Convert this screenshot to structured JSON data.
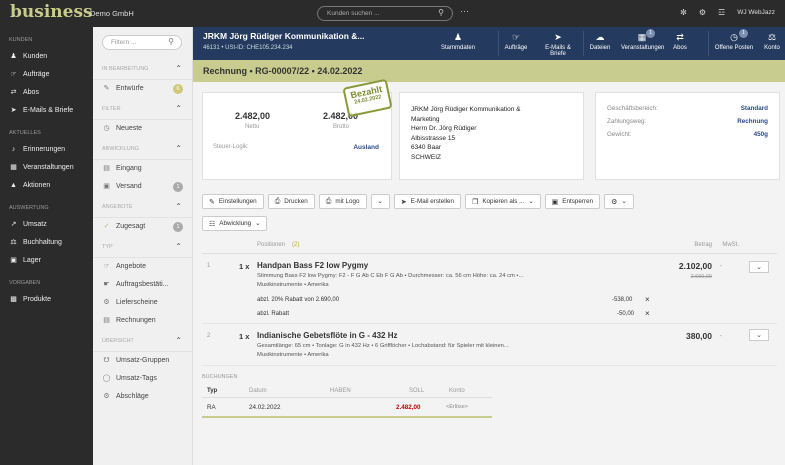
{
  "app": {
    "logo": "business",
    "company": "Demo GmbH",
    "user": "WJ WebJazz"
  },
  "search": {
    "placeholder": "Kunden suchen ..."
  },
  "leftnav": {
    "sections": [
      {
        "label": "KUNDEN",
        "items": [
          {
            "label": "Kunden",
            "icon": "person-icon"
          },
          {
            "label": "Aufträge",
            "icon": "handshake-icon"
          },
          {
            "label": "Abos",
            "icon": "repeat-icon"
          },
          {
            "label": "E-Mails & Briefe",
            "icon": "send-icon"
          }
        ]
      },
      {
        "label": "AKTUELLES",
        "items": [
          {
            "label": "Erinnerungen",
            "icon": "bell-icon"
          },
          {
            "label": "Veranstaltungen",
            "icon": "calendar-icon"
          },
          {
            "label": "Aktionen",
            "icon": "megaphone-icon"
          }
        ]
      },
      {
        "label": "AUSWERTUNG",
        "items": [
          {
            "label": "Umsatz",
            "icon": "chart-icon"
          },
          {
            "label": "Buchhaltung",
            "icon": "scale-icon"
          },
          {
            "label": "Lager",
            "icon": "forklift-icon"
          }
        ]
      },
      {
        "label": "VORGABEN",
        "items": [
          {
            "label": "Produkte",
            "icon": "box-icon"
          }
        ]
      }
    ]
  },
  "side2": {
    "filter_placeholder": "Filtern ...",
    "groups": [
      {
        "label": "IN BEARBEITUNG",
        "items": [
          {
            "label": "Entwürfe",
            "badge": "6"
          }
        ]
      },
      {
        "label": "FILTER",
        "items": [
          {
            "label": "Neueste"
          }
        ]
      },
      {
        "label": "ABWICKLUNG",
        "items": [
          {
            "label": "Eingang"
          },
          {
            "label": "Versand",
            "badge": "1"
          }
        ]
      },
      {
        "label": "ANGEBOTE",
        "items": [
          {
            "label": "Zugesagt",
            "badge": "1"
          }
        ]
      },
      {
        "label": "TYP",
        "items": [
          {
            "label": "Angebote"
          },
          {
            "label": "Auftragsbestäti..."
          },
          {
            "label": "Lieferscheine"
          },
          {
            "label": "Rechnungen"
          }
        ]
      },
      {
        "label": "ÜBERSICHT",
        "items": [
          {
            "label": "Umsatz-Gruppen"
          },
          {
            "label": "Umsatz-Tags"
          },
          {
            "label": "Abschläge"
          }
        ]
      }
    ]
  },
  "customer": {
    "name": "JRKM Jörg Rüdiger Kommunikation &...",
    "sub": "46131 • USt-ID: CHE105.234.234"
  },
  "header_tabs": [
    "Stammdaten",
    "Aufträge",
    "E-Mails & Briefe",
    "Dateien",
    "Veranstaltungen",
    "Abos",
    "Offene Posten",
    "Konto"
  ],
  "header_badges": {
    "veranstaltungen": "1",
    "offene_posten": "1"
  },
  "doc": {
    "title": "Rechnung • RG-00007/22 • 24.02.2022"
  },
  "totals": {
    "netto_value": "2.482,00",
    "netto_label": "Netto",
    "brutto_value": "2.482,00",
    "brutto_label": "Brutto",
    "steuer_label": "Steuer-Logik:",
    "steuer_value": "Ausland"
  },
  "stamp": {
    "text": "Bezahlt",
    "date": "24.02.2022"
  },
  "address": {
    "lines": [
      "JRKM Jörg Rüdiger Kommunikation &",
      "Marketing",
      "Herrn Dr. Jörg Rüdiger",
      "Albisstrasse 15",
      "6340 Baar",
      "SCHWEIZ"
    ]
  },
  "info": [
    {
      "label": "Geschäftsbereich:",
      "value": "Standard"
    },
    {
      "label": "Zahlungsweg:",
      "value": "Rechnung"
    },
    {
      "label": "Gewicht:",
      "value": "450g"
    }
  ],
  "toolbar": {
    "einstellungen": "Einstellungen",
    "drucken": "Drucken",
    "mit_logo": "mit Logo",
    "email": "E-Mail erstellen",
    "kopieren": "Kopieren als ...",
    "entsperren": "Entsperren",
    "abwicklung": "Abwicklung"
  },
  "positions": {
    "header_label": "Positionen",
    "count": "(2)",
    "betrag_label": "Betrag",
    "mwst_label": "MwSt.",
    "rows": [
      {
        "num": "1",
        "qty": "1 x",
        "title": "Handpan Bass F2 low Pygmy",
        "desc": "Stimmung Bass F2 low Pygmy: F2 - F G Ab C Eb F G Ab • Durchmesser: ca. 56 cm Höhe: ca. 24 cm •...",
        "origin": "Musikinstrumente • Amerika",
        "amount": "2.102,00",
        "old_amount": "2.690,00",
        "mwst": "-",
        "discounts": [
          {
            "label": "abzl. 20% Rabatt von 2.690,00",
            "value": "-538,00"
          },
          {
            "label": "abzl. Rabatt",
            "value": "-50,00"
          }
        ]
      },
      {
        "num": "2",
        "qty": "1 x",
        "title": "Indianische Gebetsflöte in G - 432 Hz",
        "desc": "Gesamtlänge: 65 cm • Tonlage: G in 432 Hz • 6 Grifflöcher • Lochabstand: für Spieler mit kleinen...",
        "origin": "Musikinstrumente • Amerika",
        "amount": "380,00",
        "mwst": "-"
      }
    ]
  },
  "buchungen": {
    "title": "BUCHUNGEN",
    "headers": [
      "Typ",
      "Datum",
      "HABEN",
      "SOLL",
      "Konto"
    ],
    "row": {
      "typ": "RA",
      "datum": "24.02.2022",
      "haben": "",
      "soll": "2.482,00",
      "konto": "<Erlöse>"
    }
  },
  "colors": {
    "accent": "#c9cc8f",
    "header": "#243a5e",
    "link": "#2a4a8a",
    "red": "#c00000"
  }
}
